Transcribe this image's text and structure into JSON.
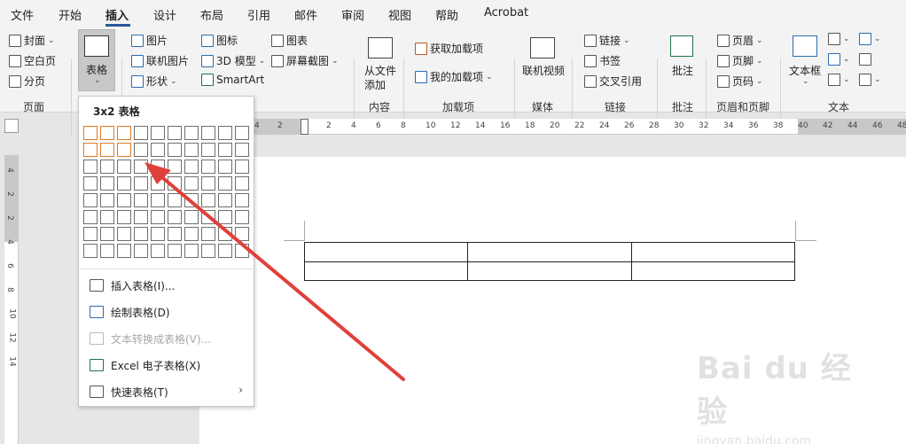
{
  "tabs": [
    "文件",
    "开始",
    "插入",
    "设计",
    "布局",
    "引用",
    "邮件",
    "审阅",
    "视图",
    "帮助",
    "Acrobat"
  ],
  "active_tab_index": 2,
  "ribbon": {
    "pages": {
      "cover": "封面",
      "blank": "空白页",
      "break": "分页",
      "group": "页面"
    },
    "table": {
      "label": "表格"
    },
    "illustrations": {
      "pictures": "图片",
      "online_pictures": "联机图片",
      "shapes": "形状",
      "icons": "图标",
      "models_3d": "3D 模型",
      "smartart": "SmartArt",
      "chart": "图表",
      "screenshot": "屏幕截图"
    },
    "content": {
      "from_file_1": "从文件",
      "from_file_2": "添加",
      "group": "内容"
    },
    "addins": {
      "get": "获取加载项",
      "mine": "我的加载项",
      "group": "加载项"
    },
    "media": {
      "online_video": "联机视频",
      "group": "媒体"
    },
    "links": {
      "link": "链接",
      "bookmark": "书签",
      "cross_ref": "交叉引用",
      "group": "链接"
    },
    "comments": {
      "comment": "批注",
      "group": "批注"
    },
    "header_footer": {
      "header": "页眉",
      "footer": "页脚",
      "page_number": "页码",
      "group": "页眉和页脚"
    },
    "text": {
      "textbox": "文本框",
      "group": "文本"
    }
  },
  "ruler": {
    "left_labels": [
      "4",
      "2"
    ],
    "right_labels": [
      "2",
      "4",
      "6",
      "8",
      "10",
      "12",
      "14",
      "16",
      "18",
      "20",
      "22",
      "24",
      "26",
      "28",
      "30",
      "32",
      "34",
      "36",
      "38",
      "40",
      "42",
      "44",
      "46",
      "48"
    ],
    "vertical_labels": [
      "4",
      "2",
      "2",
      "4",
      "6",
      "8",
      "10",
      "12",
      "14"
    ]
  },
  "table_dropdown": {
    "title": "3x2 表格",
    "grid_cols": 10,
    "grid_rows": 8,
    "selected_cols": 3,
    "selected_rows": 2,
    "menu": [
      {
        "label": "插入表格(I)...",
        "disabled": false
      },
      {
        "label": "绘制表格(D)",
        "disabled": false
      },
      {
        "label": "文本转换成表格(V)...",
        "disabled": true
      },
      {
        "label": "Excel 电子表格(X)",
        "disabled": false
      },
      {
        "label": "快速表格(T)",
        "disabled": false
      }
    ],
    "submenu_arrow": "›"
  },
  "document_table": {
    "rows": 2,
    "cols": 3
  },
  "watermark": {
    "main": "Bai du 经验",
    "sub": "jingyan.baidu.com"
  },
  "colors": {
    "accent": "#2b579a",
    "highlight": "#e07b27",
    "arrow": "#e0403a"
  }
}
